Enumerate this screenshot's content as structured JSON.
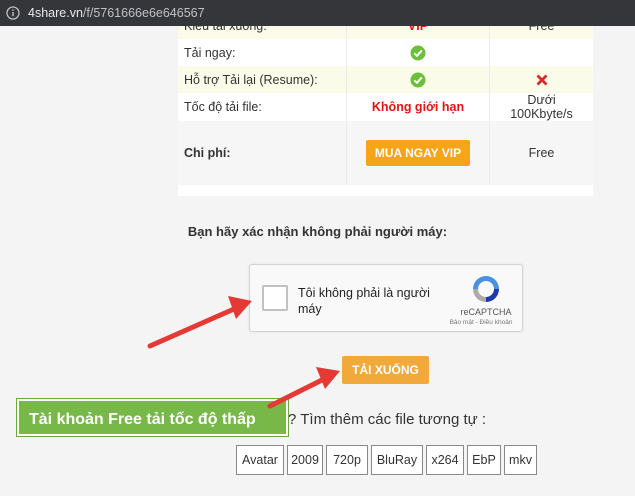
{
  "browser": {
    "url_host": "4share.vn",
    "url_path": "/f/5761666e6e646567"
  },
  "comparison": {
    "rows": [
      {
        "label": "Kiểu tải xuống:",
        "vip": "VIP",
        "free": "Free"
      },
      {
        "label": "Tải ngay:",
        "vip_icon": "check-icon",
        "free": ""
      },
      {
        "label": "Hỗ trợ Tải lại (Resume):",
        "vip_icon": "check-icon",
        "free_icon": "cross-icon"
      },
      {
        "label": "Tốc độ tải file:",
        "vip": "Không giới hạn",
        "free": "Dưới 100Kbyte/s"
      }
    ],
    "cost": {
      "label": "Chi phí:",
      "vip_button": "MUA NGAY VIP",
      "free": "Free"
    }
  },
  "captcha": {
    "prompt": "Bạn hãy xác nhận không phải người máy:",
    "checkbox_label": "Tôi không phải là người máy",
    "brand": "reCAPTCHA",
    "terms": "Bảo mật - Điều khoản"
  },
  "download_button": "TẢI XUỐNG",
  "annotation": "Tài khoản Free tải tốc độ thấp",
  "similar_files": "? Tìm thêm các file tương tự :",
  "tags": [
    "Avatar",
    "2009",
    "720p",
    "BluRay",
    "x264",
    "EbP",
    "mkv"
  ],
  "colors": {
    "annotation_bg": "#78b848",
    "arrow": "#e53935",
    "download_btn": "#f2a93c",
    "vip_btn": "#f5a516",
    "vip_text": "#e21414"
  }
}
